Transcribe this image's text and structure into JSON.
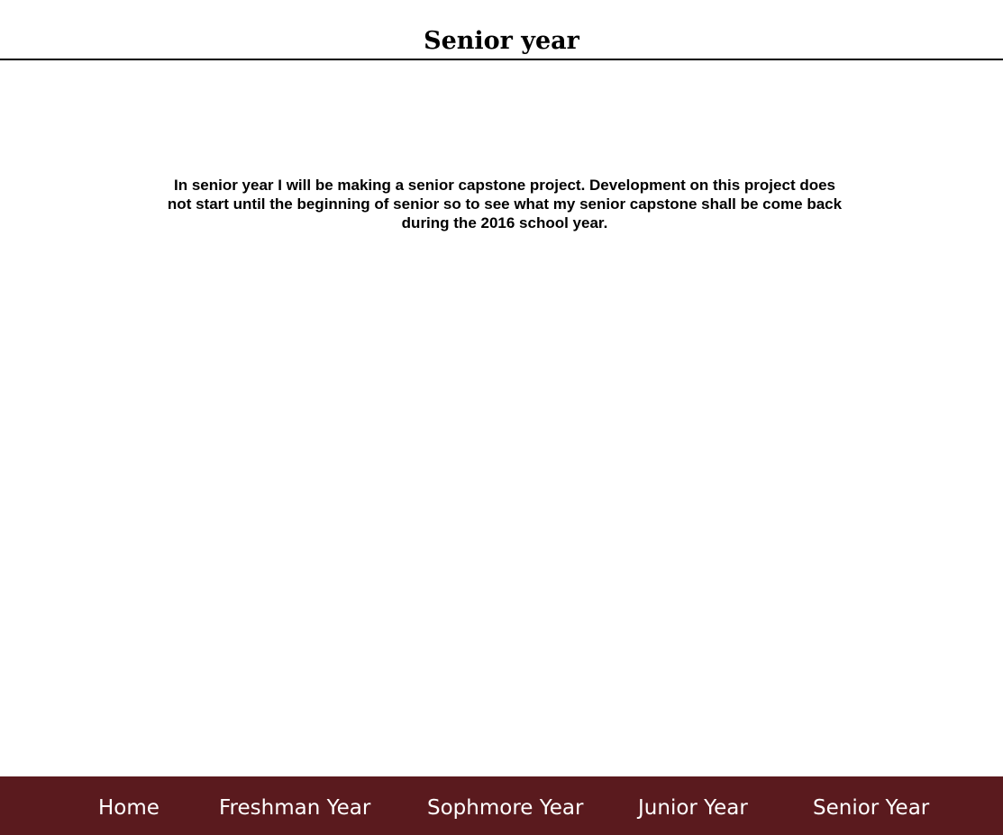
{
  "header": {
    "title": "Senior year"
  },
  "main": {
    "paragraph": "In senior year I will be making a senior capstone project. Development on this project does not start until the beginning of senior so to see what my senior capstone shall be come back during the 2016 school year."
  },
  "nav": {
    "background_color": "#5a1a1e",
    "text_color": "#ffffff",
    "items": [
      {
        "label": "Home"
      },
      {
        "label": "Freshman Year"
      },
      {
        "label": "Sophmore Year"
      },
      {
        "label": "Junior Year"
      },
      {
        "label": "Senior Year"
      }
    ]
  }
}
